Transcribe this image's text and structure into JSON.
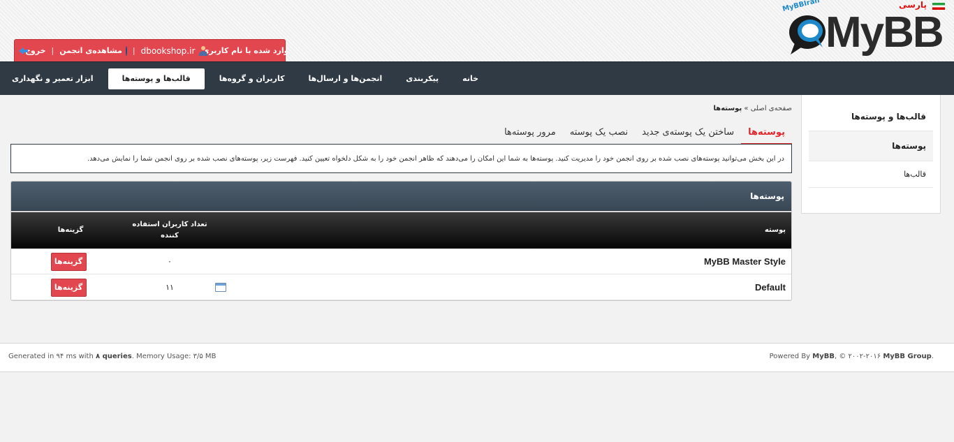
{
  "logo": {
    "wordmark": "MyBB",
    "brand_small": "MyBBIran",
    "lang_label": "پارسی"
  },
  "userbar": {
    "logged_in_label": "وارد شده با نام کاربری",
    "username": "dbookshop.ir",
    "view_forum": "مشاهده‌ی انجمن",
    "logout": "خروج"
  },
  "nav": {
    "items": [
      {
        "label": "خانه"
      },
      {
        "label": "پیکربندی"
      },
      {
        "label": "انجمن‌ها و ارسال‌ها"
      },
      {
        "label": "کاربران و گروه‌ها"
      },
      {
        "label": "قالب‌ها و پوسته‌ها"
      },
      {
        "label": "ابزار تعمیر و نگهداری"
      }
    ],
    "active_index": 4
  },
  "sidebar": {
    "title": "قالب‌ها و پوسته‌ها",
    "items": [
      {
        "label": "پوسته‌ها"
      },
      {
        "label": "قالب‌ها"
      }
    ]
  },
  "breadcrumb": {
    "home": "صفحه‌ی اصلی",
    "separator": "»",
    "current": "پوسته‌ها"
  },
  "tabs": [
    {
      "label": "پوسته‌ها"
    },
    {
      "label": "ساختن یک پوسته‌ی جدید"
    },
    {
      "label": "نصب یک پوسته"
    },
    {
      "label": "مرور پوسته‌ها"
    }
  ],
  "description": "در این بخش می‌توانید پوسته‌های نصب شده بر روی انجمن خود را مدیریت کنید. پوسته‌ها به شما این امکان را می‌دهند که ظاهر انجمن خود را به شکل دلخواه تعیین کنید. فهرست زیر، پوسته‌های نصب شده بر روی انجمن شما را نمایش می‌دهد.",
  "panel": {
    "title": "پوسته‌ها",
    "columns": {
      "theme": "پوسته",
      "users": "تعداد کاربران استفاده کننده",
      "options": "گزینه‌ها"
    },
    "rows": [
      {
        "name": "MyBB Master Style",
        "users": "۰",
        "option": "گزینه‌ها"
      },
      {
        "name": "Default",
        "users": "۱۱",
        "option": "گزینه‌ها"
      }
    ]
  },
  "footer": {
    "generated_prefix": "Generated in ۹۴ ms with",
    "queries": "۸ queries",
    "memory": ". Memory Usage: ۳/۵ MB",
    "powered_by": "Powered By",
    "mybb": "MyBB",
    "copyright": ", © ۲۰۰۲-۲۰۱۶",
    "group": "MyBB Group",
    "dot": "."
  },
  "colors": {
    "accent_red": "#e2474f",
    "nav_bg": "#2f3a44",
    "panel_head": "#3a4855"
  }
}
